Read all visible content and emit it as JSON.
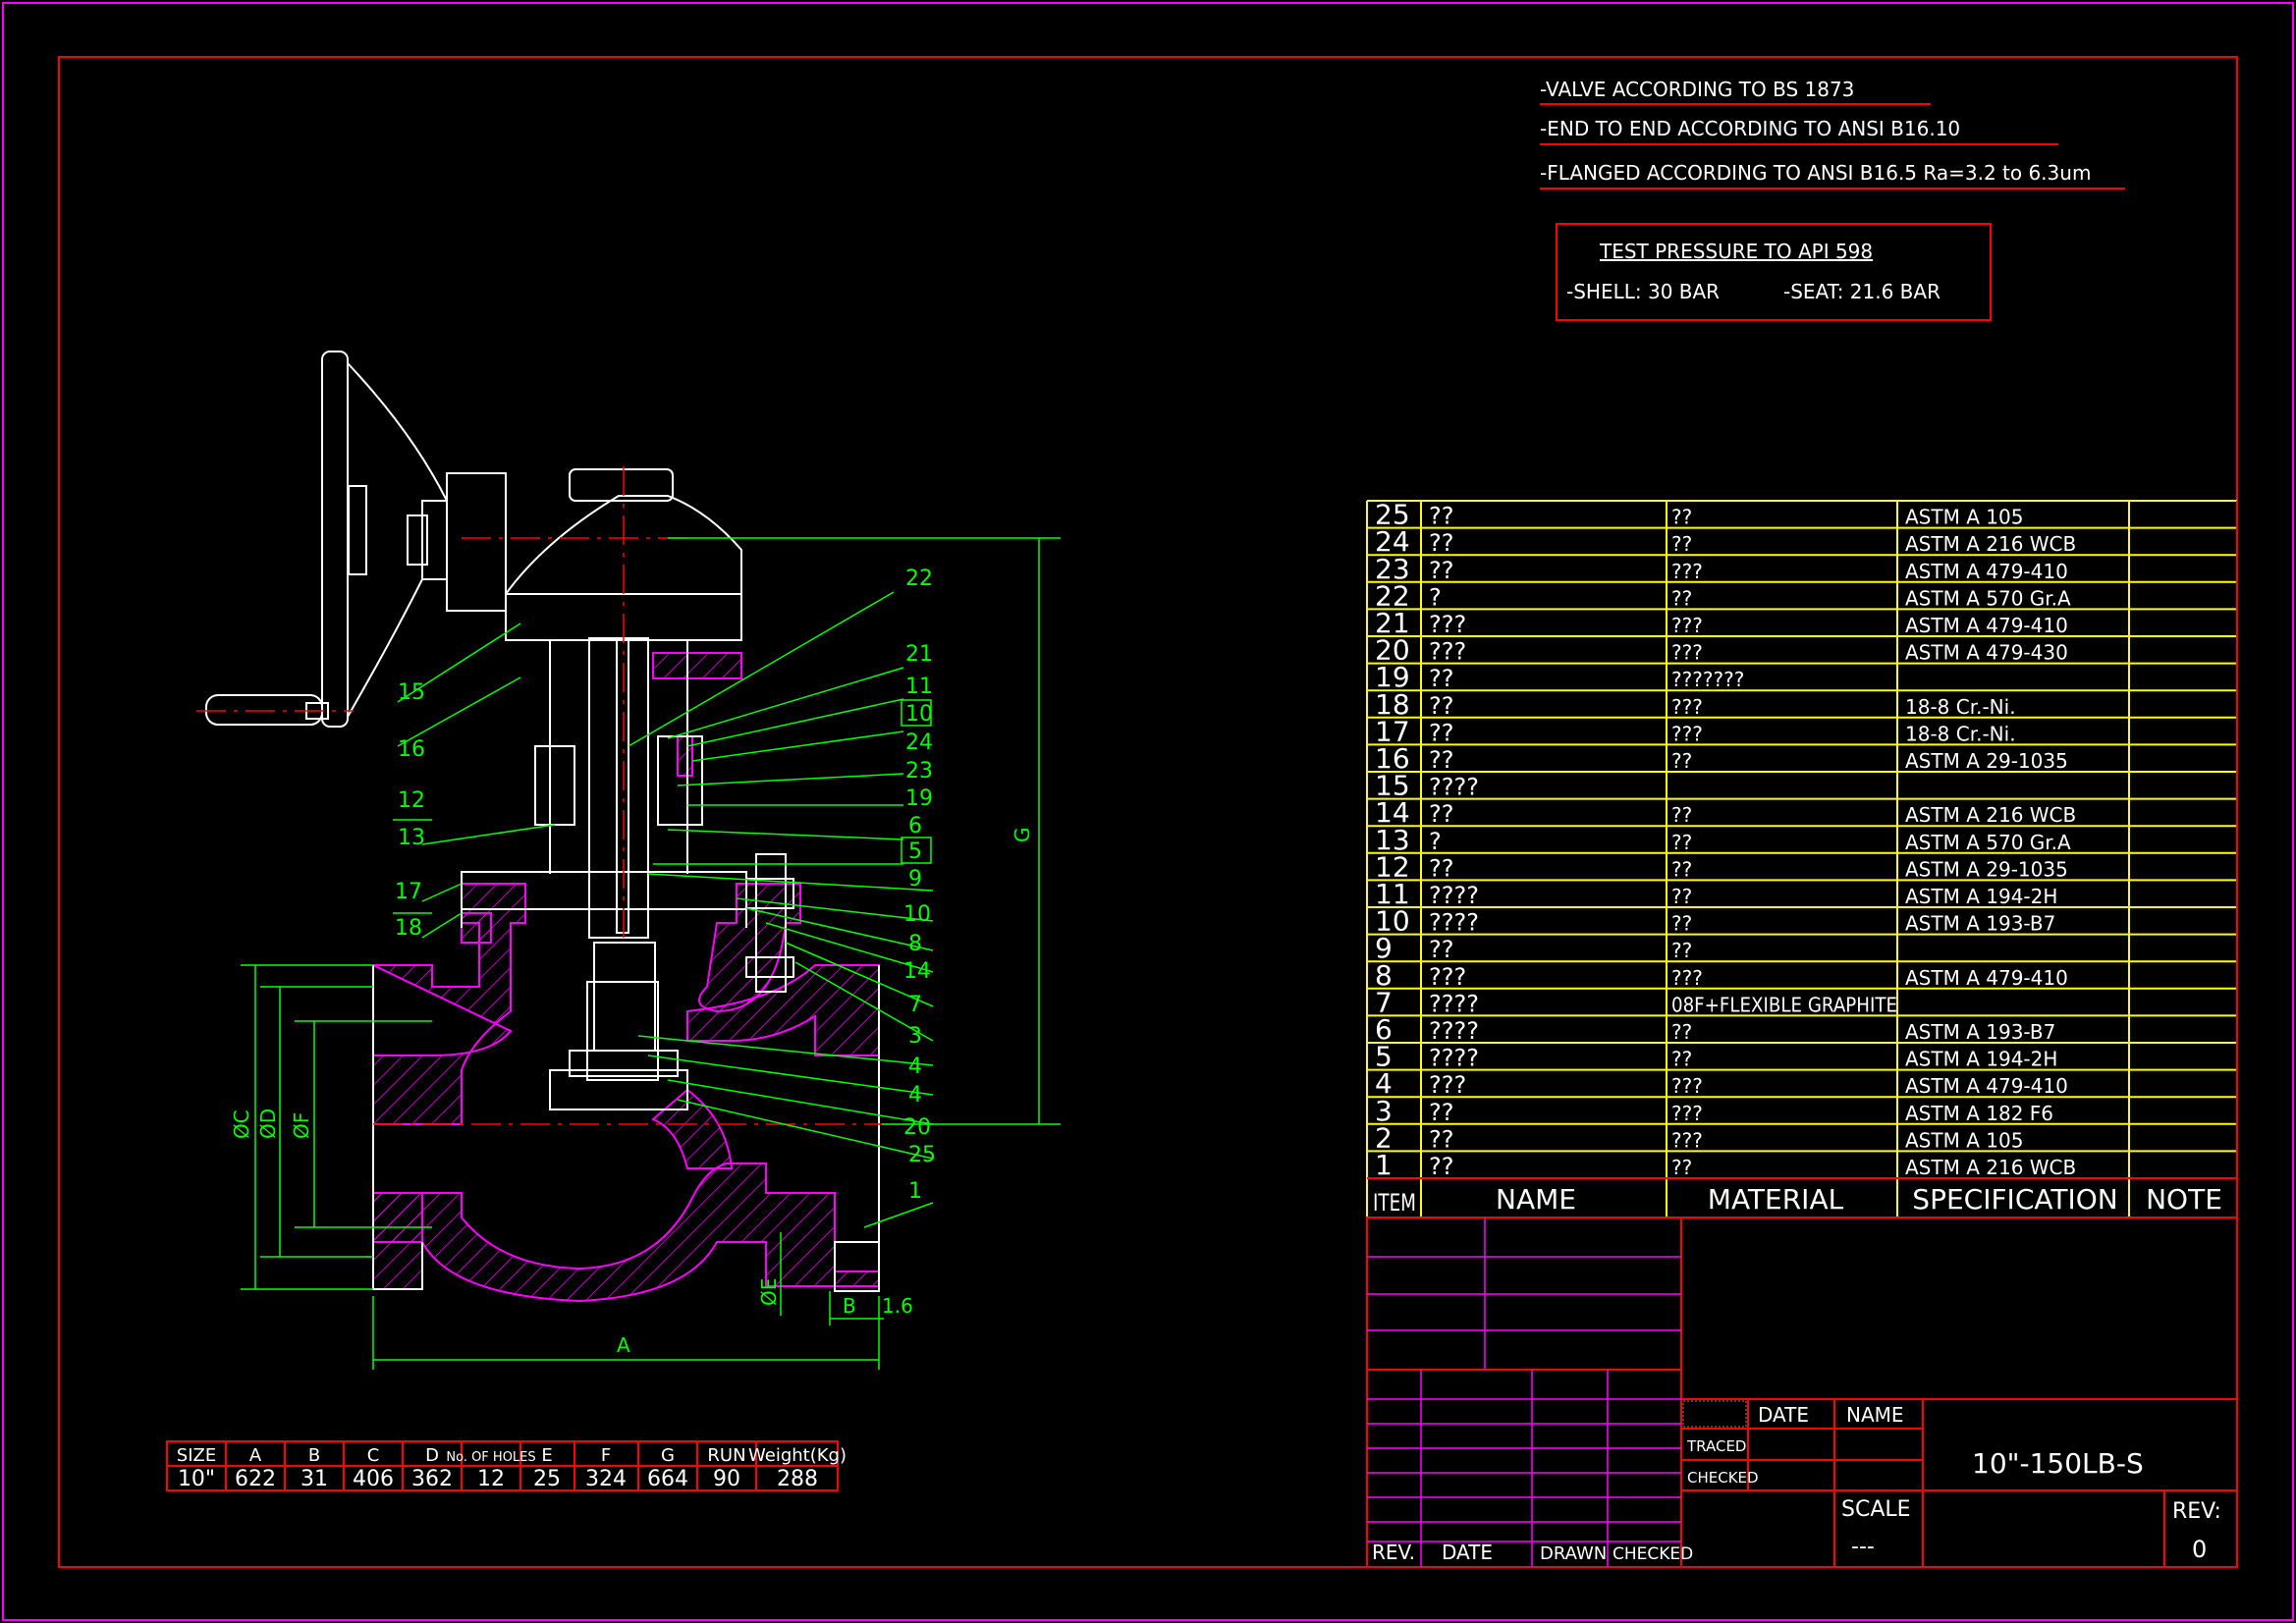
{
  "notes": [
    "-VALVE ACCORDING TO BS 1873",
    "-END TO END ACCORDING TO ANSI B16.10",
    "-FLANGED ACCORDING TO ANSI B16.5 Ra=3.2 to 6.3um"
  ],
  "test_box": {
    "title": "TEST PRESSURE TO API 598",
    "shell": "-SHELL: 30 BAR",
    "seat": "-SEAT: 21.6 BAR"
  },
  "callouts": [
    "22",
    "21",
    "11",
    "10",
    "24",
    "23",
    "19",
    "6",
    "5",
    "9",
    "10",
    "8",
    "14",
    "7",
    "3",
    "4",
    "4",
    "20",
    "25",
    "1",
    "15",
    "16",
    "12",
    "13",
    "17",
    "18"
  ],
  "dim_labels": {
    "g": "G",
    "a": "A",
    "b": "B",
    "b_extra": "1.6",
    "c": "ØC",
    "d": "ØD",
    "f": "ØF",
    "e": "ØE"
  },
  "size_table": {
    "headers": [
      "SIZE",
      "A",
      "B",
      "C",
      "D",
      "No. OF HOLES",
      "E",
      "F",
      "G",
      "RUN",
      "Weight(Kg)"
    ],
    "row": [
      "10\"",
      "622",
      "31",
      "406",
      "362",
      "12",
      "25",
      "324",
      "664",
      "90",
      "288"
    ]
  },
  "parts": [
    {
      "item": "25",
      "name": "??",
      "material": "??",
      "spec": "ASTM A 105"
    },
    {
      "item": "24",
      "name": "??",
      "material": "??",
      "spec": "ASTM A 216 WCB"
    },
    {
      "item": "23",
      "name": "??",
      "material": "???",
      "spec": "ASTM A 479-410"
    },
    {
      "item": "22",
      "name": "?",
      "material": "??",
      "spec": "ASTM A 570 Gr.A"
    },
    {
      "item": "21",
      "name": "???",
      "material": "???",
      "spec": "ASTM A 479-410"
    },
    {
      "item": "20",
      "name": "???",
      "material": "???",
      "spec": "ASTM A 479-430"
    },
    {
      "item": "19",
      "name": "??",
      "material": "???????",
      "spec": ""
    },
    {
      "item": "18",
      "name": "??",
      "material": "???",
      "spec": "18-8 Cr.-Ni."
    },
    {
      "item": "17",
      "name": "??",
      "material": "???",
      "spec": "18-8 Cr.-Ni."
    },
    {
      "item": "16",
      "name": "??",
      "material": "??",
      "spec": "ASTM A 29-1035"
    },
    {
      "item": "15",
      "name": "????",
      "material": "",
      "spec": ""
    },
    {
      "item": "14",
      "name": "??",
      "material": "??",
      "spec": "ASTM A 216 WCB"
    },
    {
      "item": "13",
      "name": "?",
      "material": "??",
      "spec": "ASTM A 570 Gr.A"
    },
    {
      "item": "12",
      "name": "??",
      "material": "??",
      "spec": "ASTM A 29-1035"
    },
    {
      "item": "11",
      "name": "????",
      "material": "??",
      "spec": "ASTM A 194-2H"
    },
    {
      "item": "10",
      "name": "????",
      "material": "??",
      "spec": "ASTM A 193-B7"
    },
    {
      "item": "9",
      "name": "??",
      "material": "??",
      "spec": ""
    },
    {
      "item": "8",
      "name": "???",
      "material": "???",
      "spec": "ASTM A 479-410"
    },
    {
      "item": "7",
      "name": "????",
      "material": "08F+FLEXIBLE GRAPHITE",
      "spec": ""
    },
    {
      "item": "6",
      "name": "????",
      "material": "??",
      "spec": "ASTM A 193-B7"
    },
    {
      "item": "5",
      "name": "????",
      "material": "??",
      "spec": "ASTM A 194-2H"
    },
    {
      "item": "4",
      "name": "???",
      "material": "???",
      "spec": "ASTM A 479-410"
    },
    {
      "item": "3",
      "name": "??",
      "material": "???",
      "spec": "ASTM A 182 F6"
    },
    {
      "item": "2",
      "name": "??",
      "material": "???",
      "spec": "ASTM A 105"
    },
    {
      "item": "1",
      "name": "??",
      "material": "??",
      "spec": "ASTM A 216 WCB"
    }
  ],
  "parts_header": {
    "item": "ITEM",
    "name": "NAME",
    "material": "MATERIAL",
    "spec": "SPECIFICATION",
    "note": "NOTE"
  },
  "title_block": {
    "date": "DATE",
    "name": "NAME",
    "traced": "TRACED",
    "checked": "CHECKED",
    "scale": "SCALE",
    "scale_val": "---",
    "rev": "REV:",
    "rev_val": "0",
    "drawing_no": "10\"-150LB-S",
    "rev_cols": [
      "REV.",
      "DATE",
      "DRAWN",
      "CHECKED"
    ]
  },
  "colors": {
    "border": "#ff0000",
    "text": "#ffffff",
    "dim": "#00ff00",
    "hatch": "#ff00ff",
    "table": "#ffff00",
    "center": "#ff0000"
  }
}
